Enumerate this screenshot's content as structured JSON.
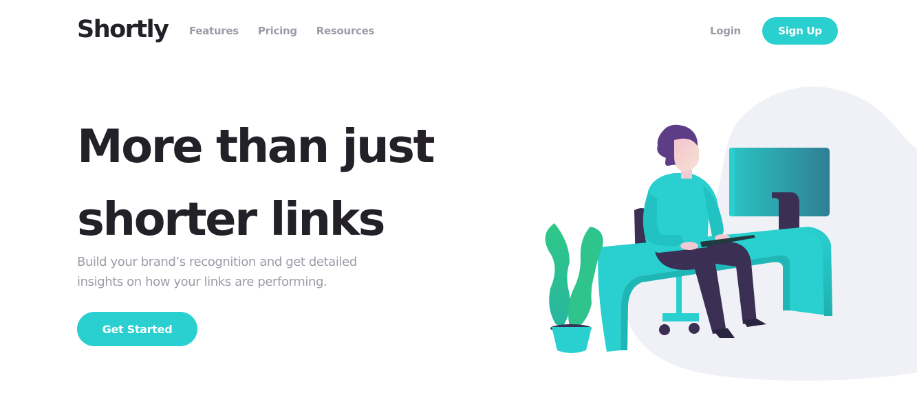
{
  "header": {
    "logo": "Shortly",
    "nav": [
      {
        "label": "Features"
      },
      {
        "label": "Pricing"
      },
      {
        "label": "Resources"
      }
    ],
    "login_label": "Login",
    "signup_label": "Sign Up"
  },
  "hero": {
    "title_line1": "More than just",
    "title_line2": "shorter links",
    "subtitle_line1": "Build your brand’s recognition and get detailed",
    "subtitle_line2": "insights on how your links are performing.",
    "cta_label": "Get Started",
    "illustration": "person-working-at-desk-illustration"
  },
  "colors": {
    "primary": "#2acfcf",
    "dark": "#232127",
    "gray": "#9e9aa7",
    "blob": "#f0f1f6",
    "violet": "#3b3054"
  }
}
